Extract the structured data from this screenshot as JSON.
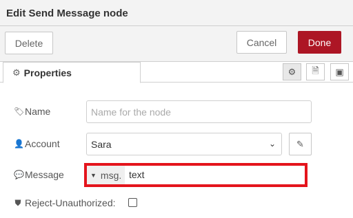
{
  "dialog": {
    "title": "Edit Send Message node"
  },
  "toolbar": {
    "delete_label": "Delete",
    "cancel_label": "Cancel",
    "done_label": "Done",
    "done_color": "#ad1625"
  },
  "tabs": {
    "properties_label": "Properties"
  },
  "tab_icons": [
    "gear-icon",
    "document-icon",
    "frame-icon"
  ],
  "form": {
    "name": {
      "label": "Name",
      "placeholder": "Name for the node",
      "value": ""
    },
    "account": {
      "label": "Account",
      "value": "Sara"
    },
    "message": {
      "label": "Message",
      "type_label": "msg.",
      "value": "text"
    },
    "reject_unauthorized": {
      "label": "Reject-Unauthorized:",
      "checked": false
    }
  },
  "highlight_color": "#e4141c"
}
